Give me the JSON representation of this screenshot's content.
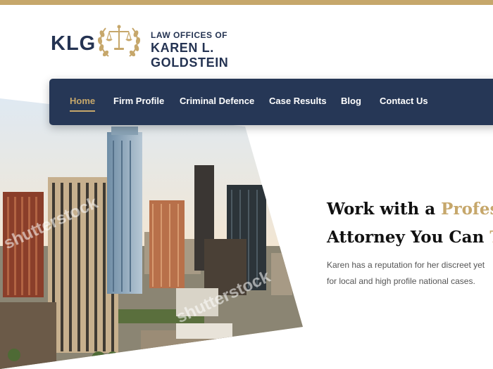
{
  "brand": {
    "mark": "KLG",
    "line1": "LAW OFFICES OF",
    "line2": "KAREN L. GOLDSTEIN"
  },
  "nav": {
    "items": [
      {
        "label": "Home",
        "active": true
      },
      {
        "label": "Firm Profile",
        "active": false
      },
      {
        "label": "Criminal Defence",
        "active": false
      },
      {
        "label": "Case Results",
        "active": false
      },
      {
        "label": "Blog",
        "active": false
      },
      {
        "label": "Contact Us",
        "active": false
      }
    ]
  },
  "hero": {
    "title_line1_plain": "Work with a ",
    "title_line1_accent": "Profess",
    "title_line2_plain": "Attorney You Can ",
    "title_line2_accent": "T",
    "body_line1": "Karen has a reputation for her discreet yet",
    "body_line2": "for local and high profile national cases."
  },
  "watermark": {
    "text": "shutterstock"
  },
  "colors": {
    "accent": "#c6a76b",
    "navy": "#263756",
    "text_dark": "#111111",
    "text_body": "#555555"
  }
}
